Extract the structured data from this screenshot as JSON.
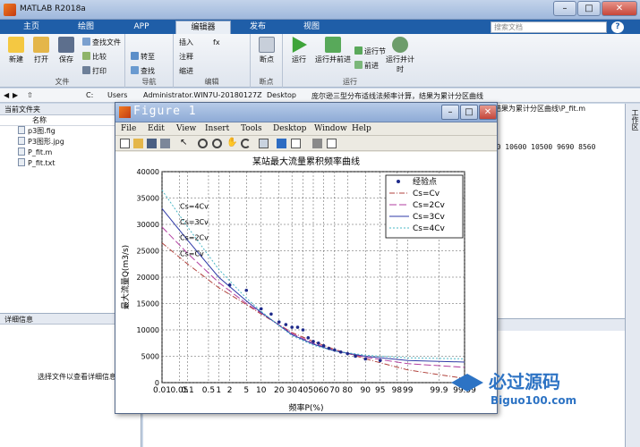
{
  "app": {
    "title": "MATLAB R2018a"
  },
  "tabs": [
    "主页",
    "绘图",
    "APP",
    "编辑器",
    "发布",
    "视图"
  ],
  "search": {
    "placeholder": "搜索文档"
  },
  "ribbon": {
    "file_group": {
      "label": "文件",
      "new": "新建",
      "open": "打开",
      "save": "保存",
      "find_files": "查找文件",
      "compare": "比较",
      "print": "打印"
    },
    "nav_group": {
      "label": "导航",
      "goto": "转至",
      "find": "查找"
    },
    "edit_group": {
      "label": "编辑",
      "insert": "插入",
      "comment": "注释",
      "indent": "缩进",
      "fx": "fx"
    },
    "breakpoint_group": {
      "label": "断点",
      "breakpoint": "断点"
    },
    "run_group": {
      "label": "运行",
      "run": "运行",
      "run_advance": "运行并前进",
      "run_section": "运行节",
      "advance": "前进",
      "run_time": "运行并计时"
    }
  },
  "address": [
    "C:",
    "Users",
    "Administrator.WIN7U-20180127Z",
    "Desktop",
    "庞尔逊三型分布适线法频率计算，结果为累计分区曲线"
  ],
  "left_panel": {
    "title": "当前文件夹",
    "column": "名称",
    "files": [
      "p3图.fig",
      "P3图形.jpg",
      "P_fit.m",
      "P_fit.txt"
    ],
    "details_title": "详细信息",
    "details_msg": "选择文件以查看详细信息"
  },
  "editor": {
    "tab_label": "结果为累计分区曲线\\P_fit.m",
    "line_text": "700  10600  10500  9690  8560"
  },
  "side_label": "工作区",
  "figure": {
    "title": "Figure 1",
    "menu": [
      "File",
      "Edit",
      "View",
      "Insert",
      "Tools",
      "Desktop",
      "Window",
      "Help"
    ]
  },
  "chart_data": {
    "type": "line",
    "title": "某站最大流量累积频率曲线",
    "xlabel": "频率P(%)",
    "ylabel": "最大流量Q(m3/s)",
    "ylim": [
      0,
      40000
    ],
    "yticks": [
      0,
      5000,
      10000,
      15000,
      20000,
      25000,
      30000,
      35000,
      40000
    ],
    "xticks": [
      "0.01",
      "0.05",
      "0.1",
      "0.5",
      "1",
      "2",
      "5",
      "10",
      "20",
      "30",
      "40",
      "50",
      "60",
      "70",
      "80",
      "90",
      "95",
      "98",
      "99",
      "99.9",
      "99.99"
    ],
    "grid": true,
    "legend_position": "top-right",
    "legend": [
      "经验点",
      "Cs=Cv",
      "Cs=2Cv",
      "Cs=3Cv",
      "Cs=4Cv"
    ],
    "annotations": [
      "Cs=4Cv",
      "Cs=3Cv",
      "Cs=2Cv",
      "Cs=Cv"
    ],
    "series": [
      {
        "name": "Cs=Cv",
        "color": "#b0423c",
        "dash": "6,2,1,2",
        "x": [
          "0.01",
          "0.1",
          "1",
          "5",
          "10",
          "30",
          "50",
          "70",
          "90",
          "99",
          "99.99"
        ],
        "values": [
          26500,
          22500,
          18000,
          14800,
          13000,
          9500,
          7800,
          6300,
          4500,
          2400,
          800
        ]
      },
      {
        "name": "Cs=2Cv",
        "color": "#b23ea0",
        "dash": "8,3",
        "x": [
          "0.01",
          "0.1",
          "1",
          "5",
          "10",
          "30",
          "50",
          "70",
          "90",
          "99",
          "99.99"
        ],
        "values": [
          29500,
          24500,
          19000,
          15000,
          13200,
          9300,
          7500,
          6100,
          4800,
          3600,
          2900
        ]
      },
      {
        "name": "Cs=3Cv",
        "color": "#2f3aa7",
        "dash": "",
        "x": [
          "0.01",
          "0.1",
          "1",
          "5",
          "10",
          "30",
          "50",
          "70",
          "90",
          "99",
          "99.99"
        ],
        "values": [
          33000,
          27000,
          20000,
          15500,
          13300,
          9100,
          7300,
          6000,
          5000,
          4200,
          3900
        ]
      },
      {
        "name": "Cs=4Cv",
        "color": "#4cb8c7",
        "dash": "2,2",
        "x": [
          "0.01",
          "0.1",
          "1",
          "5",
          "10",
          "30",
          "50",
          "70",
          "90",
          "99",
          "99.99"
        ],
        "values": [
          36500,
          29500,
          21500,
          16000,
          13500,
          8900,
          7100,
          6000,
          5200,
          4700,
          4500
        ]
      }
    ],
    "points": {
      "name": "经验点",
      "x": [
        "2",
        "5",
        "10",
        "15",
        "20",
        "25",
        "30",
        "35",
        "40",
        "45",
        "50",
        "55",
        "60",
        "65",
        "70",
        "75",
        "80",
        "85",
        "90",
        "95"
      ],
      "values": [
        18500,
        17500,
        14000,
        13000,
        11500,
        11000,
        10500,
        10500,
        10000,
        8500,
        7800,
        7500,
        7000,
        6500,
        6200,
        5800,
        5500,
        5000,
        4500,
        4200
      ]
    }
  }
}
